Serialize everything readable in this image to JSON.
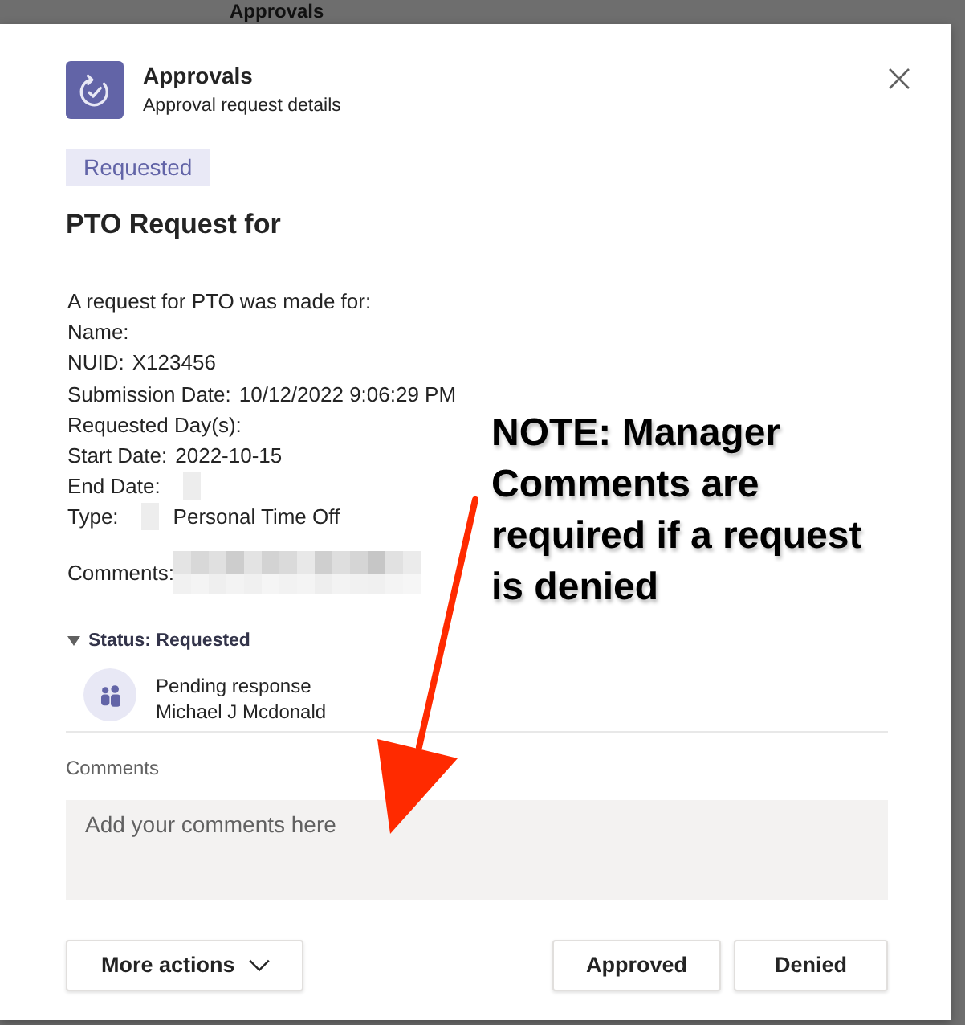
{
  "background": {
    "title": "Approvals"
  },
  "dialog": {
    "app_name": "Approvals",
    "subtitle": "Approval request details",
    "status_badge": "Requested",
    "title": "PTO Request for",
    "details": [
      {
        "label": "A request for PTO was made for:",
        "redacted": false
      },
      {
        "label": "Name:",
        "redacted": false
      },
      {
        "label": "NUID:",
        "value": "X123456",
        "redacted": false
      },
      {
        "label": "Submission Date:",
        "value": "10/12/2022 9:06:29 PM",
        "redacted": false
      },
      {
        "label": "Requested Day(s):",
        "redacted": false
      },
      {
        "label": "Start Date:",
        "value": "2022-10-15",
        "redacted": false
      },
      {
        "label": "End Date:",
        "redacted": true
      },
      {
        "label": "Type:",
        "value": "Personal Time Off",
        "redacted": true
      }
    ],
    "comments_line": {
      "label": "Comments:",
      "redacted": true
    },
    "status": {
      "label": "Status: Requested",
      "expanded": true,
      "approvers": [
        {
          "status": "Pending response",
          "name": "Michael J Mcdonald"
        }
      ]
    },
    "comments_field": {
      "label": "Comments",
      "placeholder": "Add your comments here"
    },
    "buttons": [
      {
        "label": "More actions",
        "kind": "menu"
      },
      {
        "label": "Approved",
        "kind": "plain"
      },
      {
        "label": "Denied",
        "kind": "plain"
      }
    ]
  },
  "annotation": {
    "text": "NOTE: Manager Comments are required if a request is denied"
  }
}
